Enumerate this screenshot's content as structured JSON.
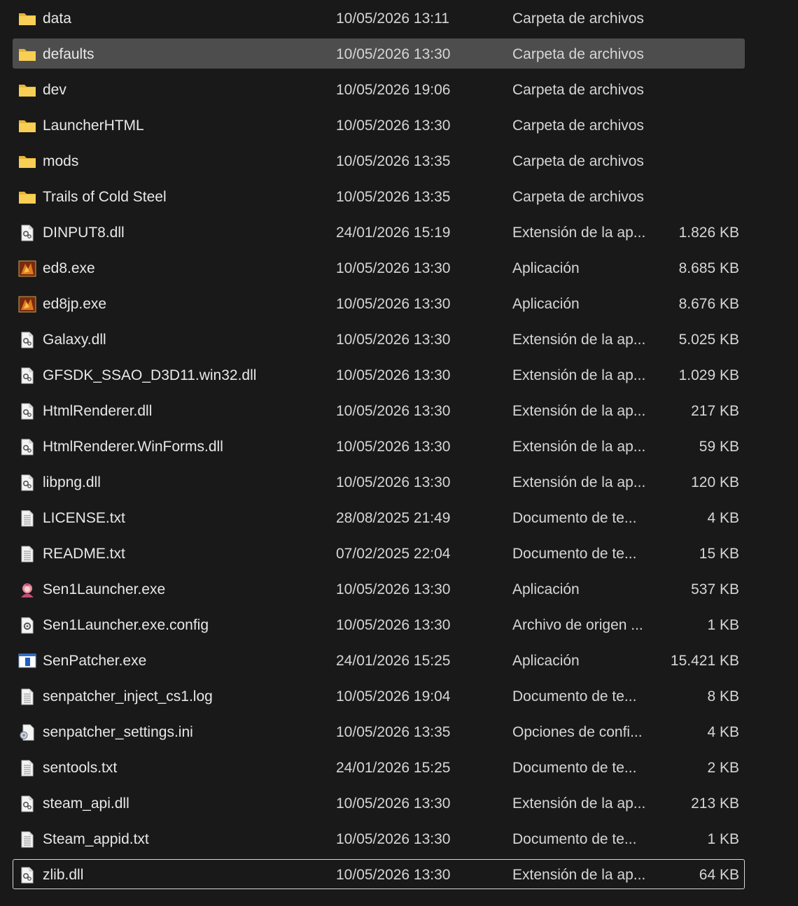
{
  "colors": {
    "background": "#191919",
    "selected_row": "#4d4d4d",
    "focus_border": "#d9d9d9",
    "folder": "#f5c84c",
    "text": "#e6e6e6"
  },
  "files": [
    {
      "name": "data",
      "date": "10/05/2026 13:11",
      "type": "Carpeta de archivos",
      "size": "",
      "icon": "folder-icon"
    },
    {
      "name": "defaults",
      "date": "10/05/2026 13:30",
      "type": "Carpeta de archivos",
      "size": "",
      "icon": "folder-icon",
      "selected": true
    },
    {
      "name": "dev",
      "date": "10/05/2026 19:06",
      "type": "Carpeta de archivos",
      "size": "",
      "icon": "folder-icon"
    },
    {
      "name": "LauncherHTML",
      "date": "10/05/2026 13:30",
      "type": "Carpeta de archivos",
      "size": "",
      "icon": "folder-icon"
    },
    {
      "name": "mods",
      "date": "10/05/2026 13:35",
      "type": "Carpeta de archivos",
      "size": "",
      "icon": "folder-icon"
    },
    {
      "name": "Trails of Cold Steel",
      "date": "10/05/2026 13:35",
      "type": "Carpeta de archivos",
      "size": "",
      "icon": "folder-icon"
    },
    {
      "name": "DINPUT8.dll",
      "date": "24/01/2026 15:19",
      "type": "Extensión de la ap...",
      "size": "1.826 KB",
      "icon": "dll-icon"
    },
    {
      "name": "ed8.exe",
      "date": "10/05/2026 13:30",
      "type": "Aplicación",
      "size": "8.685 KB",
      "icon": "game-exe-icon"
    },
    {
      "name": "ed8jp.exe",
      "date": "10/05/2026 13:30",
      "type": "Aplicación",
      "size": "8.676 KB",
      "icon": "game-exe-icon"
    },
    {
      "name": "Galaxy.dll",
      "date": "10/05/2026 13:30",
      "type": "Extensión de la ap...",
      "size": "5.025 KB",
      "icon": "dll-icon"
    },
    {
      "name": "GFSDK_SSAO_D3D11.win32.dll",
      "date": "10/05/2026 13:30",
      "type": "Extensión de la ap...",
      "size": "1.029 KB",
      "icon": "dll-icon"
    },
    {
      "name": "HtmlRenderer.dll",
      "date": "10/05/2026 13:30",
      "type": "Extensión de la ap...",
      "size": "217 KB",
      "icon": "dll-icon"
    },
    {
      "name": "HtmlRenderer.WinForms.dll",
      "date": "10/05/2026 13:30",
      "type": "Extensión de la ap...",
      "size": "59 KB",
      "icon": "dll-icon"
    },
    {
      "name": "libpng.dll",
      "date": "10/05/2026 13:30",
      "type": "Extensión de la ap...",
      "size": "120 KB",
      "icon": "dll-icon"
    },
    {
      "name": "LICENSE.txt",
      "date": "28/08/2025 21:49",
      "type": "Documento de te...",
      "size": "4 KB",
      "icon": "text-file-icon"
    },
    {
      "name": "README.txt",
      "date": "07/02/2025 22:04",
      "type": "Documento de te...",
      "size": "15 KB",
      "icon": "text-file-icon"
    },
    {
      "name": "Sen1Launcher.exe",
      "date": "10/05/2026 13:30",
      "type": "Aplicación",
      "size": "537 KB",
      "icon": "launcher-exe-icon"
    },
    {
      "name": "Sen1Launcher.exe.config",
      "date": "10/05/2026 13:30",
      "type": "Archivo de origen ...",
      "size": "1 KB",
      "icon": "config-file-icon"
    },
    {
      "name": "SenPatcher.exe",
      "date": "24/01/2026 15:25",
      "type": "Aplicación",
      "size": "15.421 KB",
      "icon": "window-exe-icon"
    },
    {
      "name": "senpatcher_inject_cs1.log",
      "date": "10/05/2026 19:04",
      "type": "Documento de te...",
      "size": "8 KB",
      "icon": "text-file-icon"
    },
    {
      "name": "senpatcher_settings.ini",
      "date": "10/05/2026 13:35",
      "type": "Opciones de confi...",
      "size": "4 KB",
      "icon": "settings-file-icon"
    },
    {
      "name": "sentools.txt",
      "date": "24/01/2026 15:25",
      "type": "Documento de te...",
      "size": "2 KB",
      "icon": "text-file-icon"
    },
    {
      "name": "steam_api.dll",
      "date": "10/05/2026 13:30",
      "type": "Extensión de la ap...",
      "size": "213 KB",
      "icon": "dll-icon"
    },
    {
      "name": "Steam_appid.txt",
      "date": "10/05/2026 13:30",
      "type": "Documento de te...",
      "size": "1 KB",
      "icon": "text-file-icon"
    },
    {
      "name": "zlib.dll",
      "date": "10/05/2026 13:30",
      "type": "Extensión de la ap...",
      "size": "64 KB",
      "icon": "dll-icon",
      "focused": true
    }
  ]
}
